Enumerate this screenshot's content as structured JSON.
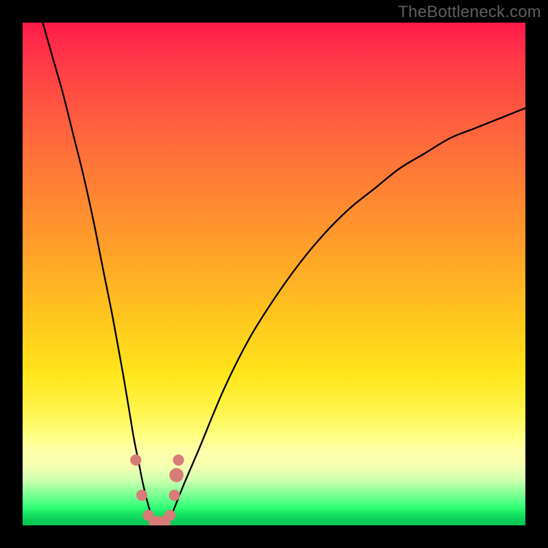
{
  "watermark": "TheBottleneck.com",
  "chart_data": {
    "type": "line",
    "title": "",
    "xlabel": "",
    "ylabel": "",
    "xlim": [
      0,
      100
    ],
    "ylim": [
      0,
      100
    ],
    "grid": false,
    "background_gradient": {
      "orientation": "vertical",
      "stops": [
        {
          "pos": 0.0,
          "color": "#ff1a4a"
        },
        {
          "pos": 0.3,
          "color": "#ff7a36"
        },
        {
          "pos": 0.7,
          "color": "#ffe61a"
        },
        {
          "pos": 0.85,
          "color": "#ffffa8"
        },
        {
          "pos": 1.0,
          "color": "#02c24e"
        }
      ]
    },
    "series": [
      {
        "name": "bottleneck-curve",
        "color": "#000000",
        "x": [
          4,
          6,
          8,
          10,
          12,
          14,
          16,
          18,
          20,
          22,
          23,
          24,
          25,
          26,
          27,
          28,
          29,
          30,
          32,
          35,
          40,
          45,
          50,
          55,
          60,
          65,
          70,
          75,
          80,
          85,
          90,
          95,
          100
        ],
        "y": [
          100,
          93,
          86,
          78,
          70,
          61,
          51,
          41,
          30,
          18,
          13,
          8,
          4,
          1,
          0,
          0,
          1,
          3,
          8,
          15,
          27,
          37,
          45,
          52,
          58,
          63,
          67,
          71,
          74,
          77,
          79,
          81,
          83
        ]
      }
    ],
    "markers": [
      {
        "name": "dot",
        "color": "#d87c78",
        "x": 22.5,
        "y": 13,
        "r": 1.1
      },
      {
        "name": "dot",
        "color": "#d87c78",
        "x": 23.7,
        "y": 6,
        "r": 1.1
      },
      {
        "name": "dot",
        "color": "#d87c78",
        "x": 25.0,
        "y": 2,
        "r": 1.1
      },
      {
        "name": "dot",
        "color": "#d87c78",
        "x": 26.5,
        "y": 0.5,
        "r": 1.4
      },
      {
        "name": "dot",
        "color": "#d87c78",
        "x": 28.0,
        "y": 0.5,
        "r": 1.4
      },
      {
        "name": "dot",
        "color": "#d87c78",
        "x": 29.3,
        "y": 2,
        "r": 1.1
      },
      {
        "name": "dot",
        "color": "#d87c78",
        "x": 30.2,
        "y": 6,
        "r": 1.1
      },
      {
        "name": "dot",
        "color": "#d87c78",
        "x": 30.6,
        "y": 10,
        "r": 1.4
      },
      {
        "name": "dot",
        "color": "#d87c78",
        "x": 31.0,
        "y": 13,
        "r": 1.1
      }
    ]
  }
}
